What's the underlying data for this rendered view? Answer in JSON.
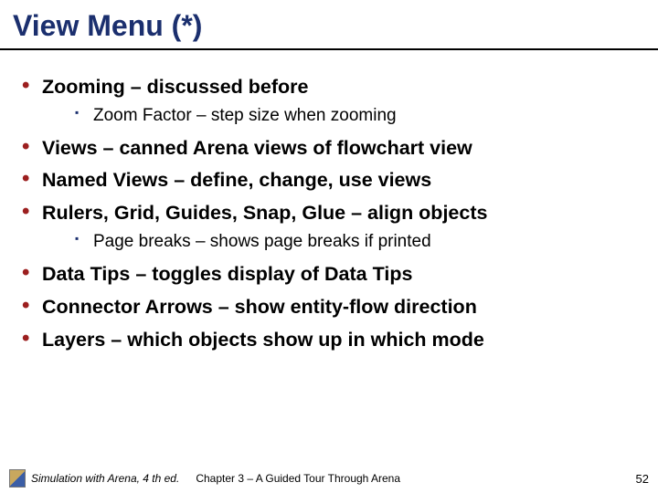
{
  "title": "View Menu (*)",
  "bullets": {
    "b1": "Zooming – discussed before",
    "b1s1": "Zoom Factor – step size when zooming",
    "b2": "Views – canned Arena views of flowchart view",
    "b3": "Named Views – define, change, use views",
    "b4": "Rulers, Grid, Guides, Snap, Glue – align objects",
    "b4s1": "Page breaks – shows page breaks if printed",
    "b5": "Data Tips – toggles display of Data Tips",
    "b6": "Connector Arrows – show entity-flow direction",
    "b7": "Layers – which objects show up in which mode"
  },
  "footer": {
    "credit": "Simulation with Arena, 4 th ed.",
    "chapter": "Chapter 3 – A Guided Tour Through Arena",
    "page": "52"
  }
}
